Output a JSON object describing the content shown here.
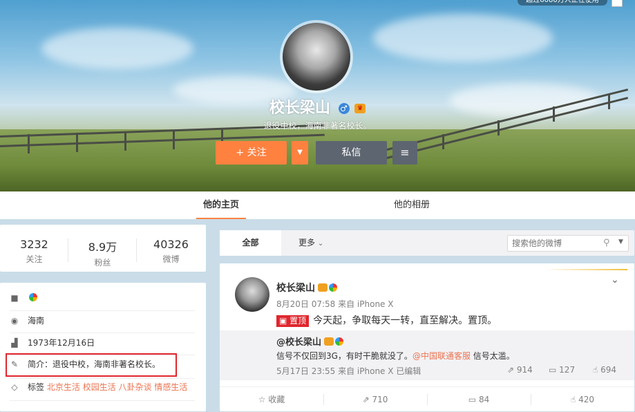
{
  "header": {
    "top_badge": "超过6080万人正在使用",
    "name": "校长梁山",
    "gender_icon": "♂",
    "bio": "退役中校，海南非著名校长。",
    "follow_label": "+ 关注",
    "message_label": "私信",
    "menu_icon": "≡"
  },
  "tabs": [
    {
      "label": "他的主页",
      "active": true
    },
    {
      "label": "他的相册",
      "active": false
    }
  ],
  "stats": [
    {
      "value": "3232",
      "label": "关注"
    },
    {
      "value": "8.9万",
      "label": "粉丝"
    },
    {
      "value": "40326",
      "label": "微博"
    }
  ],
  "info": {
    "location": "海南",
    "birthday": "1973年12月16日",
    "intro_label": "简介：",
    "intro": "退役中校，海南非著名校长。",
    "tags_label": "标签",
    "tags": [
      "北京生活",
      "校园生活",
      "八卦杂谈",
      "情感生活"
    ]
  },
  "filter": {
    "all_label": "全部",
    "more_label": "更多",
    "search_placeholder": "搜索他的微博"
  },
  "post": {
    "author": "校长梁山",
    "meta": "8月20日 07:58 来自 iPhone X",
    "pin_label": "置顶",
    "text": "今天起，争取每天一转，直至解决。置顶。",
    "repost": {
      "author": "@校长梁山",
      "text_before": "信号不仅回到3G，有时干脆就没了。",
      "mention": "@中国联通客服",
      "text_after": " 信号太滥。",
      "meta": "5月17日 23:55 来自 iPhone X  已编辑",
      "forwards": "914",
      "comments": "127",
      "likes": "694"
    },
    "actions": {
      "favorite": "收藏",
      "forward": "710",
      "comment": "84",
      "like": "420"
    }
  },
  "colors": {
    "accent": "#ff8140",
    "dark_button": "#5d6570",
    "highlight_box": "#e0262d",
    "link": "#eb7350"
  }
}
